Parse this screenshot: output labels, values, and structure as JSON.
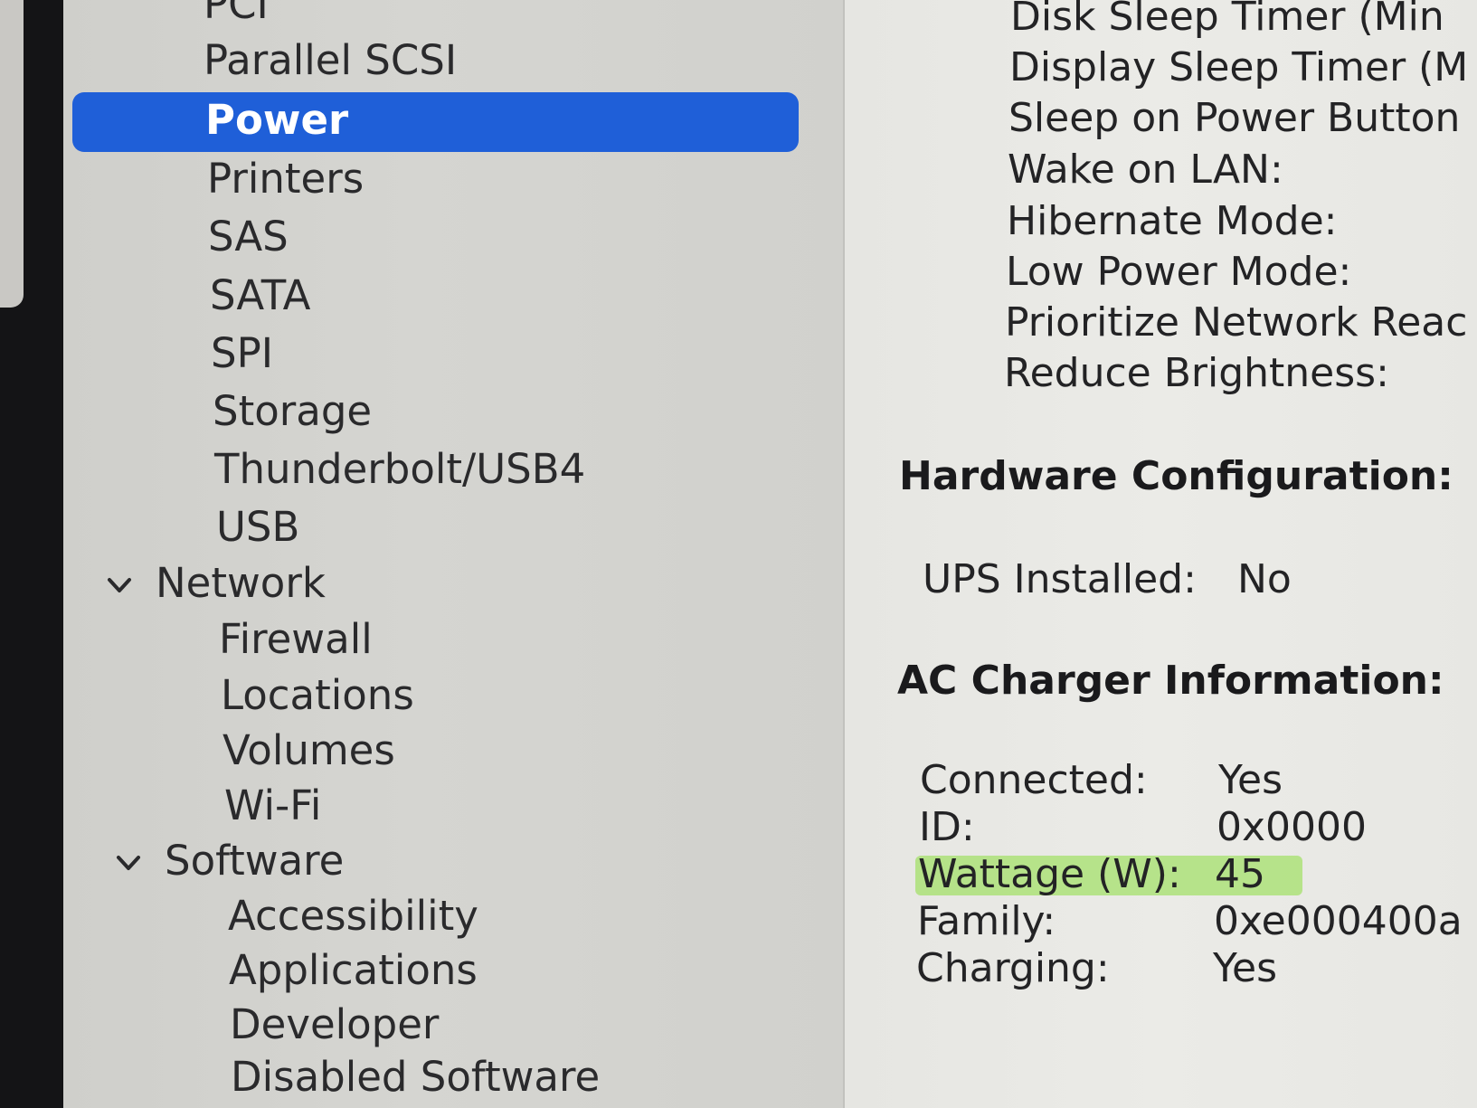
{
  "sidebar": {
    "hardware_items": [
      "PCI",
      "Parallel SCSI",
      "Power",
      "Printers",
      "SAS",
      "SATA",
      "SPI",
      "Storage",
      "Thunderbolt/USB4",
      "USB"
    ],
    "selected_item": "Power",
    "network": {
      "label": "Network",
      "items": [
        "Firewall",
        "Locations",
        "Volumes",
        "Wi-Fi"
      ]
    },
    "software": {
      "label": "Software",
      "items": [
        "Accessibility",
        "Applications",
        "Developer",
        "Disabled Software"
      ]
    }
  },
  "content": {
    "power_settings": [
      "Disk Sleep Timer (Min",
      "Display Sleep Timer (M",
      "Sleep on Power Button",
      "Wake on LAN:",
      "Hibernate Mode:",
      "Low Power Mode:",
      "Prioritize Network Reac",
      "Reduce Brightness:"
    ],
    "hardware_configuration": {
      "heading": "Hardware Configuration:",
      "ups_label": "UPS Installed:",
      "ups_value": "No"
    },
    "ac_charger": {
      "heading": "AC Charger Information:",
      "rows": [
        {
          "label": "Connected:",
          "value": "Yes"
        },
        {
          "label": "ID:",
          "value": "0x0000"
        },
        {
          "label": "Wattage (W):",
          "value": "45",
          "highlighted": true
        },
        {
          "label": "Family:",
          "value": "0xe000400a"
        },
        {
          "label": "Charging:",
          "value": "Yes"
        }
      ]
    }
  },
  "colors": {
    "selection": "#1f5fd8",
    "highlighter": "#96de50"
  },
  "icons": {
    "expand": "chevron-down-icon"
  }
}
